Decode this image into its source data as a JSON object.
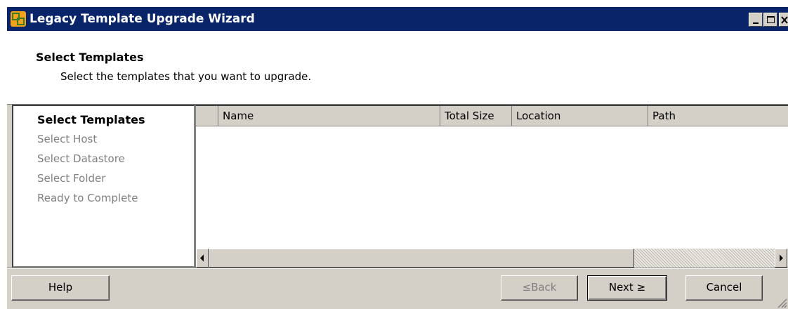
{
  "window": {
    "title": "Legacy Template Upgrade Wizard",
    "accent_color": "#0a246a",
    "icon": "vsphere-app-icon"
  },
  "header": {
    "title": "Select Templates",
    "subtitle": "Select the templates that you want to upgrade."
  },
  "steps": [
    {
      "label": "Select Templates",
      "active": true
    },
    {
      "label": "Select Host",
      "active": false
    },
    {
      "label": "Select Datastore",
      "active": false
    },
    {
      "label": "Select Folder",
      "active": false
    },
    {
      "label": "Ready to Complete",
      "active": false
    }
  ],
  "table": {
    "columns": [
      "",
      "Name",
      "Total Size",
      "Location",
      "Path"
    ],
    "rows": []
  },
  "buttons": {
    "help": "Help",
    "back": "≤Back",
    "back_enabled": false,
    "next": "Next ≥",
    "cancel": "Cancel"
  }
}
